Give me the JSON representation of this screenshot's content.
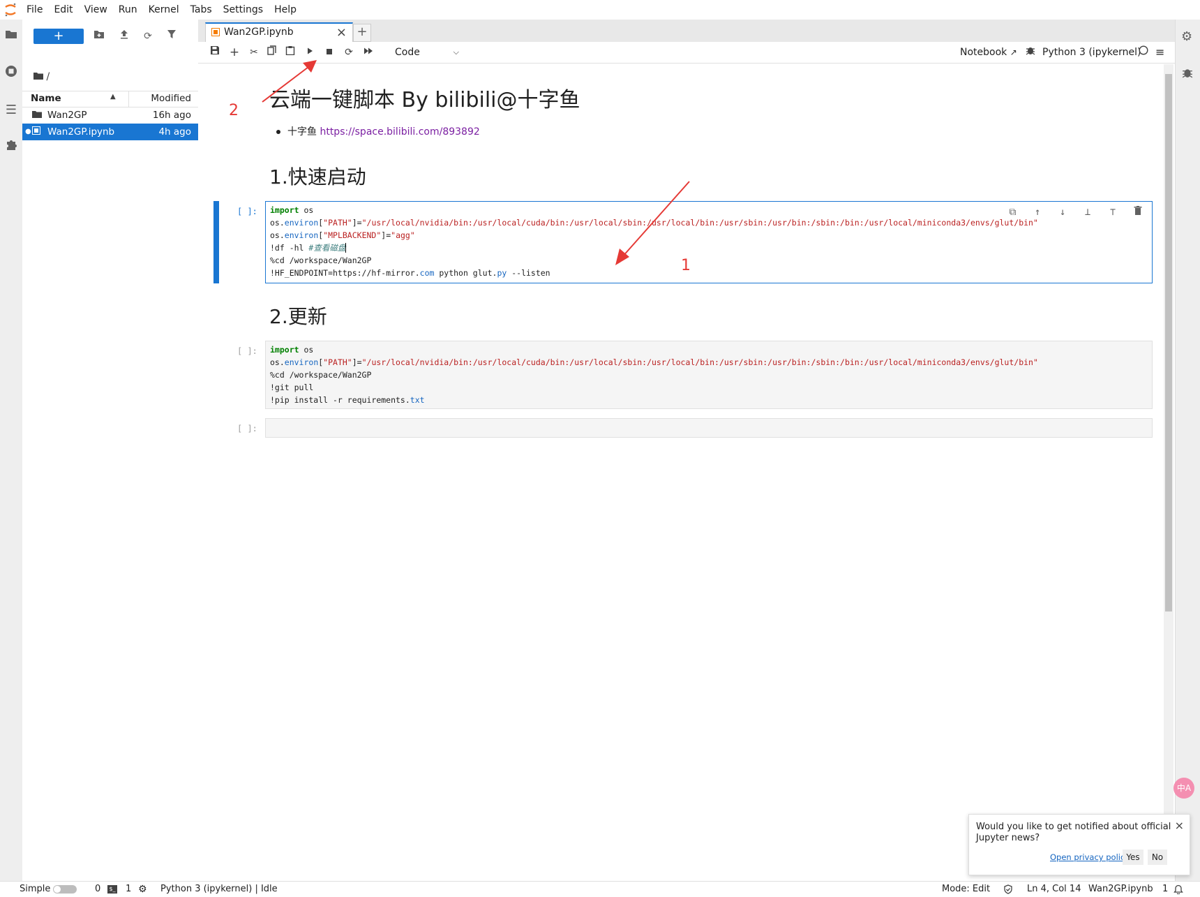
{
  "menubar": {
    "items": [
      "File",
      "Edit",
      "View",
      "Run",
      "Kernel",
      "Tabs",
      "Settings",
      "Help"
    ]
  },
  "filebrowser": {
    "new_label": "+",
    "breadcrumb": "/",
    "col_name": "Name",
    "col_modified": "Modified",
    "rows": [
      {
        "name": "Wan2GP",
        "modified": "16h ago"
      },
      {
        "name": "Wan2GP.ipynb",
        "modified": "4h ago"
      }
    ]
  },
  "tab": {
    "title": "Wan2GP.ipynb",
    "close": "×",
    "add": "+"
  },
  "toolbar": {
    "cell_type": "Code",
    "notebook_label": "Notebook",
    "kernel_label": "Python 3 (ipykernel)"
  },
  "notebook": {
    "title": "云端一键脚本 By bilibili@十字鱼",
    "bullet_text": "十字鱼 ",
    "bullet_link": "https://space.bilibili.com/893892",
    "heading1": "1.快速启动",
    "heading2": "2.更新",
    "prompt": "[ ]:",
    "cell1": {
      "l1_kw": "import",
      "l1_rest": " os",
      "l2_a": "os.",
      "l2_fn": "environ",
      "l2_b": "[",
      "l2_str1": "\"PATH\"",
      "l2_c": "]=",
      "l2_str2": "\"/usr/local/nvidia/bin:/usr/local/cuda/bin:/usr/local/sbin:/usr/local/bin:/usr/sbin:/usr/bin:/sbin:/bin:/usr/local/miniconda3/envs/glut/bin\"",
      "l3_a": "os.",
      "l3_fn": "environ",
      "l3_b": "[",
      "l3_str1": "\"MPLBACKEND\"",
      "l3_c": "]=",
      "l3_str2": "\"agg\"",
      "l4_a": "!df -hl ",
      "l4_cm": "#查看磁盘",
      "l5": "%cd /workspace/Wan2GP",
      "l6_a": "!HF_ENDPOINT=https://hf-mirror.",
      "l6_fn": "com",
      "l6_b": " python glut.",
      "l6_fn2": "py",
      "l6_c": " --listen"
    },
    "cell2": {
      "l1_kw": "import",
      "l1_rest": " os",
      "l2_a": "os.",
      "l2_fn": "environ",
      "l2_b": "[",
      "l2_str1": "\"PATH\"",
      "l2_c": "]=",
      "l2_str2": "\"/usr/local/nvidia/bin:/usr/local/cuda/bin:/usr/local/sbin:/usr/local/bin:/usr/sbin:/usr/bin:/sbin:/bin:/usr/local/miniconda3/envs/glut/bin\"",
      "l3": "%cd /workspace/Wan2GP",
      "l4": "!git pull",
      "l5_a": "!pip install -r requirements.",
      "l5_fn": "txt"
    }
  },
  "annotations": {
    "one": "1",
    "two": "2"
  },
  "toast": {
    "message": "Would you like to get notified about official Jupyter news?",
    "privacy": "Open privacy policy",
    "yes": "Yes",
    "no": "No",
    "close": "×"
  },
  "translate_label": "中A",
  "statusbar": {
    "mode_simple": "Simple",
    "terminals": "0",
    "kernels": "1",
    "kernel_status": "Python 3 (ipykernel) | Idle",
    "mode": "Mode: Edit",
    "cursor": "Ln 4, Col 14",
    "file": "Wan2GP.ipynb",
    "notifications": "1"
  },
  "colors": {
    "accent": "#1976d2",
    "annotation": "#e53935"
  }
}
